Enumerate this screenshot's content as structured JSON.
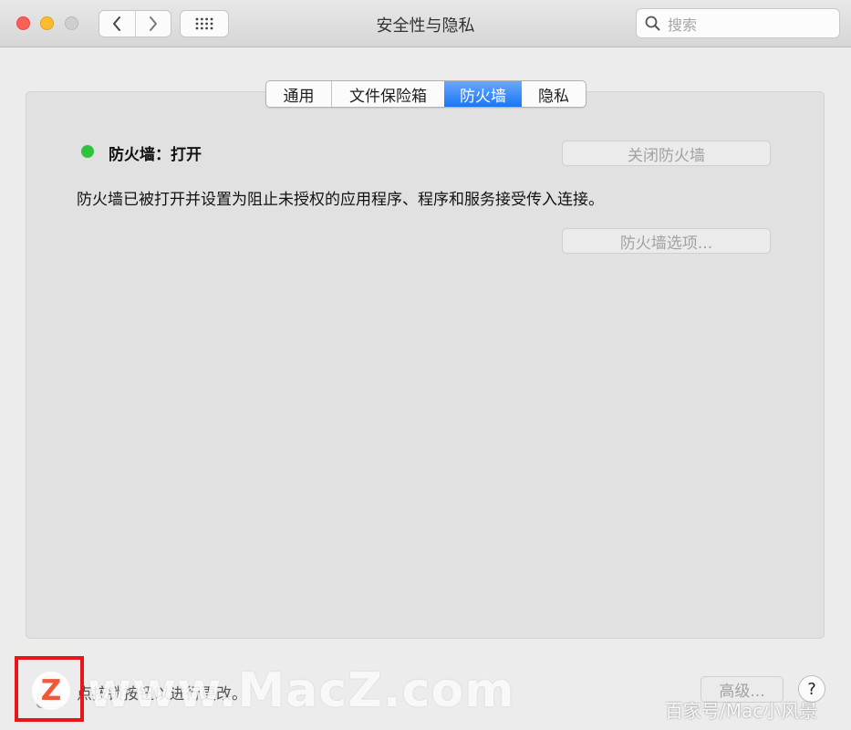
{
  "window": {
    "title": "安全性与隐私",
    "search_placeholder": "搜索"
  },
  "tabs": [
    {
      "label": "通用"
    },
    {
      "label": "文件保险箱"
    },
    {
      "label": "防火墙",
      "active": true
    },
    {
      "label": "隐私"
    }
  ],
  "firewall": {
    "status_label": "防火墙：打开",
    "status_color": "#2dc33c",
    "description": "防火墙已被打开并设置为阻止未授权的应用程序、程序和服务接受传入连接。",
    "turn_off_label": "关闭防火墙",
    "options_label": "防火墙选项..."
  },
  "footer": {
    "lock_text": "点按锁按钮以进行更改。",
    "advanced_label": "高级...",
    "help_label": "?"
  },
  "watermark": {
    "logo_letter": "Z",
    "main": "www.MacZ.com",
    "source": "百家号/Mac小风景"
  },
  "colors": {
    "accent": "#1a76f5",
    "highlight_box": "#e8161b"
  }
}
